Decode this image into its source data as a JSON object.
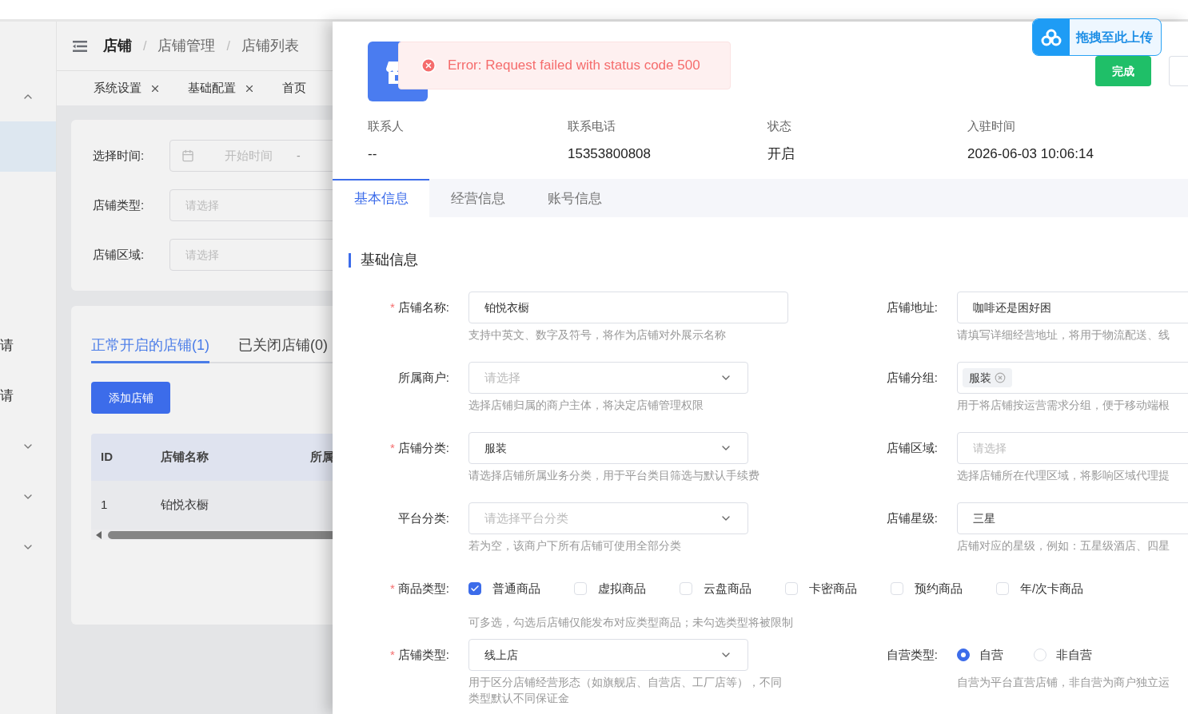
{
  "sidebar": {
    "items": [
      {
        "kind": "toggle",
        "expanded": true
      },
      {
        "kind": "band",
        "selected": true
      },
      {
        "kind": "text",
        "label": "请"
      },
      {
        "kind": "text",
        "label": "请"
      },
      {
        "kind": "toggle",
        "expanded": false
      },
      {
        "kind": "toggle",
        "expanded": false
      },
      {
        "kind": "toggle",
        "expanded": false
      }
    ]
  },
  "breadcrumb": [
    {
      "kind": "item",
      "text": "店铺"
    },
    {
      "kind": "separator",
      "text": "/"
    },
    {
      "kind": "item",
      "text": "店铺管理"
    },
    {
      "kind": "separator",
      "text": "/"
    },
    {
      "kind": "item",
      "text": "店铺列表"
    }
  ],
  "page_tabs": [
    {
      "label": "系统设置",
      "closable": true
    },
    {
      "label": "基础配置",
      "closable": true
    },
    {
      "label": "首页",
      "closable": false
    }
  ],
  "filters": [
    {
      "label": "选择时间:",
      "kind": "daterange",
      "placeholder": "开始时间",
      "separator": "-"
    },
    {
      "label": "店铺类型:",
      "kind": "select",
      "placeholder": "请选择"
    },
    {
      "label": "店铺区域:",
      "kind": "select",
      "placeholder": "请选择"
    }
  ],
  "list_tabs": [
    {
      "label": "正常开启的店铺(1)",
      "selected": true
    },
    {
      "label": "已关闭店铺(0)",
      "selected": false
    }
  ],
  "add_button": "添加店铺",
  "table": {
    "columns": [
      "ID",
      "店铺名称",
      "所属"
    ],
    "rows": [
      [
        "1",
        "铂悦衣橱"
      ]
    ]
  },
  "drawer": {
    "toast": {
      "kind": "error",
      "message": "Error: Request failed with status code 500"
    },
    "upload_badge": "拖拽至此上传",
    "done_button": "完成",
    "info": [
      {
        "label": "联系人",
        "value": "--"
      },
      {
        "label": "联系电话",
        "value": "15353800808"
      },
      {
        "label": "状态",
        "value": "开启"
      },
      {
        "label": "入驻时间",
        "value": "2026-06-03 10:06:14"
      }
    ],
    "tabs": [
      {
        "label": "基本信息",
        "selected": true
      },
      {
        "label": "经营信息",
        "selected": false
      },
      {
        "label": "账号信息",
        "selected": false
      }
    ],
    "section_title": "基础信息",
    "rows": [
      {
        "left": {
          "label": "店铺名称:",
          "required_mark": "*",
          "kind": "input",
          "value": "铂悦衣橱",
          "hint": "支持中英文、数字及符号，将作为店铺对外展示名称"
        },
        "right": {
          "label": "店铺地址:",
          "kind": "input",
          "value": "咖啡还是困好困",
          "hint": "请填写详细经营地址，将用于物流配送、线"
        }
      },
      {
        "left": {
          "label": "所属商户:",
          "kind": "select",
          "placeholder": "请选择",
          "hint": "选择店铺归属的商户主体，将决定店铺管理权限"
        },
        "right": {
          "label": "店铺分组:",
          "kind": "tags",
          "tags": [
            "服装"
          ],
          "hint": "用于将店铺按运营需求分组，便于移动端根"
        }
      },
      {
        "left": {
          "label": "店铺分类:",
          "required_mark": "*",
          "kind": "select",
          "value": "服装",
          "hint": "请选择店铺所属业务分类，用于平台类目筛选与默认手续费"
        },
        "right": {
          "label": "店铺区域:",
          "kind": "input",
          "placeholder": "请选择",
          "hint": "选择店铺所在代理区域，将影响区域代理提"
        }
      },
      {
        "left": {
          "label": "平台分类:",
          "kind": "select",
          "placeholder": "请选择平台分类",
          "hint": "若为空，该商户下所有店铺可使用全部分类"
        },
        "right": {
          "label": "店铺星级:",
          "kind": "input",
          "value": "三星",
          "hint": "店铺对应的星级，例如：五星级酒店、四星"
        }
      }
    ],
    "goods_types": {
      "label": "商品类型:",
      "required_mark": "*",
      "options": [
        {
          "label": "普通商品",
          "checked": true
        },
        {
          "label": "虚拟商品",
          "checked": false
        },
        {
          "label": "云盘商品",
          "checked": false
        },
        {
          "label": "卡密商品",
          "checked": false
        },
        {
          "label": "预约商品",
          "checked": false
        },
        {
          "label": "年/次卡商品",
          "checked": false
        }
      ],
      "hint": "可多选，勾选后店铺仅能发布对应类型商品；未勾选类型将被限制"
    },
    "last_row": {
      "left": {
        "label": "店铺类型:",
        "required_mark": "*",
        "kind": "select",
        "value": "线上店",
        "hint": "用于区分店铺经营形态（如旗舰店、自营店、工厂店等），不同类型默认不同保证金"
      },
      "right": {
        "label": "自营类型:",
        "kind": "radio",
        "options": [
          {
            "label": "自营",
            "selected": true
          },
          {
            "label": "非自营",
            "selected": false
          }
        ],
        "hint": "自营为平台直营店铺，非自营为商户独立运"
      }
    }
  }
}
